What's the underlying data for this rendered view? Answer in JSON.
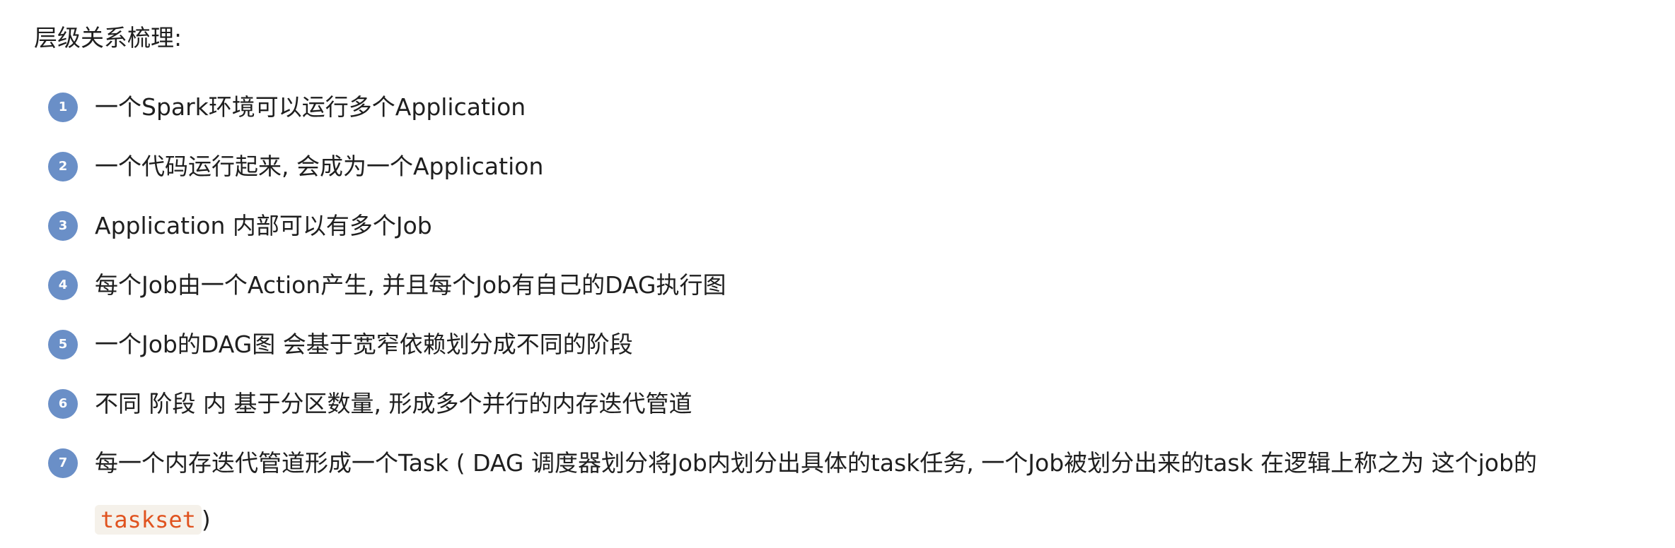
{
  "heading": "层级关系梳理:",
  "items": [
    {
      "num": "1",
      "text": "一个Spark环境可以运行多个Application"
    },
    {
      "num": "2",
      "text": "一个代码运行起来, 会成为一个Application"
    },
    {
      "num": "3",
      "text": "Application 内部可以有多个Job"
    },
    {
      "num": "4",
      "text": "每个Job由一个Action产生, 并且每个Job有自己的DAG执行图"
    },
    {
      "num": "5",
      "text": "一个Job的DAG图 会基于宽窄依赖划分成不同的阶段"
    },
    {
      "num": "6",
      "text": "不同 阶段 内 基于分区数量, 形成多个并行的内存迭代管道"
    },
    {
      "num": "7",
      "text": "每一个内存迭代管道形成一个Task ( DAG 调度器划分将Job内划分出具体的task任务, 一个Job被划分出来的task 在逻辑上称之为 这个job的 ",
      "code": "taskset",
      "tail": ")"
    }
  ],
  "colors": {
    "badge": "#6a8fc7",
    "code_text": "#e0531f",
    "code_bg": "#f5f1ea"
  }
}
